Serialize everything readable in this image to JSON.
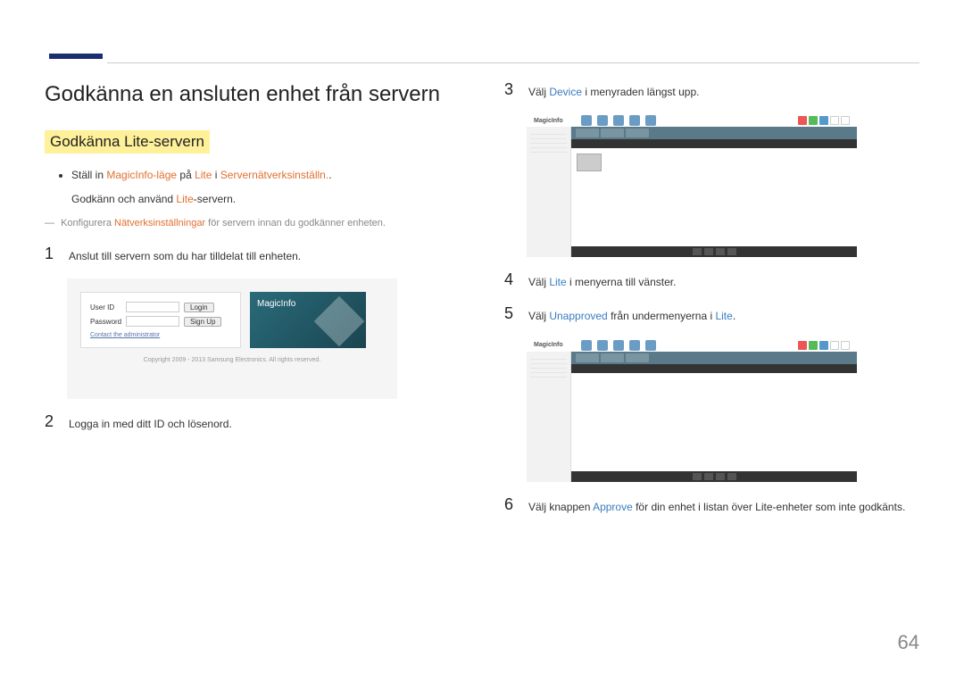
{
  "page_number": "64",
  "heading_main": "Godkänna en ansluten enhet från servern",
  "heading_sub": "Godkänna Lite-servern",
  "bullet": {
    "pre": "Ställ in ",
    "mi_mode": "MagicInfo-läge",
    "mid1": " på ",
    "lite": "Lite",
    "mid2": " i ",
    "srvnet": "Servernätverksinställn.",
    "end": "."
  },
  "bullet2": {
    "pre": "Godkänn och använd ",
    "lite": "Lite",
    "end": "-servern."
  },
  "note": {
    "pre": "Konfigurera ",
    "netset": "Nätverksinställningar",
    "end": " för servern innan du godkänner enheten."
  },
  "steps": {
    "s1": {
      "n": "1",
      "txt": "Anslut till servern som du har tilldelat till enheten."
    },
    "s2": {
      "n": "2",
      "txt": "Logga in med ditt ID och lösenord."
    },
    "s3": {
      "n": "3",
      "pre": "Välj ",
      "dev": "Device",
      "end": " i menyraden längst upp."
    },
    "s4": {
      "n": "4",
      "pre": "Välj ",
      "lite": "Lite",
      "end": " i menyerna till vänster."
    },
    "s5": {
      "n": "5",
      "pre": "Välj ",
      "unapp": "Unapproved",
      "mid": " från undermenyerna i ",
      "lite": "Lite",
      "end": "."
    },
    "s6": {
      "n": "6",
      "pre": "Välj knappen ",
      "approve": "Approve",
      "end": " för din enhet i listan över Lite-enheter som inte godkänts."
    }
  },
  "login": {
    "user": "User ID",
    "pass": "Password",
    "login_btn": "Login",
    "signup_btn": "Sign Up",
    "contact": "Contact the administrator",
    "brand": "MagicInfo",
    "copyright": "Copyright 2009 - 2013 Samsung Electronics. All rights reserved."
  },
  "ss": {
    "brand": "MagicInfo"
  }
}
